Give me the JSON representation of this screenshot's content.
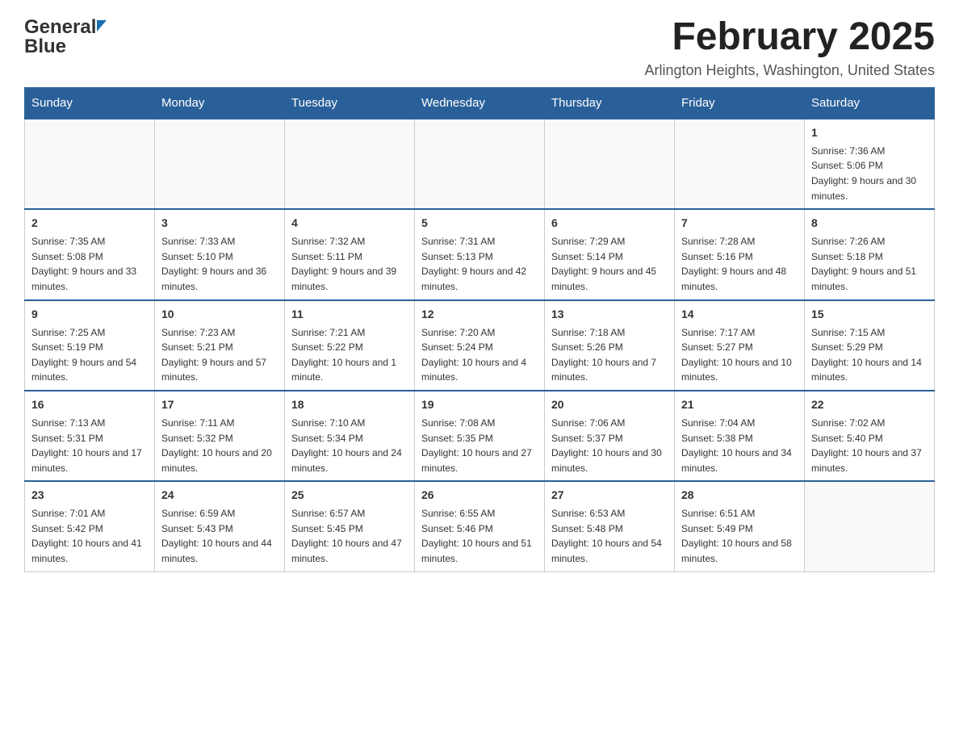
{
  "header": {
    "logo_general": "General",
    "logo_blue": "Blue",
    "month_title": "February 2025",
    "location": "Arlington Heights, Washington, United States"
  },
  "weekdays": [
    "Sunday",
    "Monday",
    "Tuesday",
    "Wednesday",
    "Thursday",
    "Friday",
    "Saturday"
  ],
  "weeks": [
    [
      {
        "day": "",
        "info": ""
      },
      {
        "day": "",
        "info": ""
      },
      {
        "day": "",
        "info": ""
      },
      {
        "day": "",
        "info": ""
      },
      {
        "day": "",
        "info": ""
      },
      {
        "day": "",
        "info": ""
      },
      {
        "day": "1",
        "info": "Sunrise: 7:36 AM\nSunset: 5:06 PM\nDaylight: 9 hours and 30 minutes."
      }
    ],
    [
      {
        "day": "2",
        "info": "Sunrise: 7:35 AM\nSunset: 5:08 PM\nDaylight: 9 hours and 33 minutes."
      },
      {
        "day": "3",
        "info": "Sunrise: 7:33 AM\nSunset: 5:10 PM\nDaylight: 9 hours and 36 minutes."
      },
      {
        "day": "4",
        "info": "Sunrise: 7:32 AM\nSunset: 5:11 PM\nDaylight: 9 hours and 39 minutes."
      },
      {
        "day": "5",
        "info": "Sunrise: 7:31 AM\nSunset: 5:13 PM\nDaylight: 9 hours and 42 minutes."
      },
      {
        "day": "6",
        "info": "Sunrise: 7:29 AM\nSunset: 5:14 PM\nDaylight: 9 hours and 45 minutes."
      },
      {
        "day": "7",
        "info": "Sunrise: 7:28 AM\nSunset: 5:16 PM\nDaylight: 9 hours and 48 minutes."
      },
      {
        "day": "8",
        "info": "Sunrise: 7:26 AM\nSunset: 5:18 PM\nDaylight: 9 hours and 51 minutes."
      }
    ],
    [
      {
        "day": "9",
        "info": "Sunrise: 7:25 AM\nSunset: 5:19 PM\nDaylight: 9 hours and 54 minutes."
      },
      {
        "day": "10",
        "info": "Sunrise: 7:23 AM\nSunset: 5:21 PM\nDaylight: 9 hours and 57 minutes."
      },
      {
        "day": "11",
        "info": "Sunrise: 7:21 AM\nSunset: 5:22 PM\nDaylight: 10 hours and 1 minute."
      },
      {
        "day": "12",
        "info": "Sunrise: 7:20 AM\nSunset: 5:24 PM\nDaylight: 10 hours and 4 minutes."
      },
      {
        "day": "13",
        "info": "Sunrise: 7:18 AM\nSunset: 5:26 PM\nDaylight: 10 hours and 7 minutes."
      },
      {
        "day": "14",
        "info": "Sunrise: 7:17 AM\nSunset: 5:27 PM\nDaylight: 10 hours and 10 minutes."
      },
      {
        "day": "15",
        "info": "Sunrise: 7:15 AM\nSunset: 5:29 PM\nDaylight: 10 hours and 14 minutes."
      }
    ],
    [
      {
        "day": "16",
        "info": "Sunrise: 7:13 AM\nSunset: 5:31 PM\nDaylight: 10 hours and 17 minutes."
      },
      {
        "day": "17",
        "info": "Sunrise: 7:11 AM\nSunset: 5:32 PM\nDaylight: 10 hours and 20 minutes."
      },
      {
        "day": "18",
        "info": "Sunrise: 7:10 AM\nSunset: 5:34 PM\nDaylight: 10 hours and 24 minutes."
      },
      {
        "day": "19",
        "info": "Sunrise: 7:08 AM\nSunset: 5:35 PM\nDaylight: 10 hours and 27 minutes."
      },
      {
        "day": "20",
        "info": "Sunrise: 7:06 AM\nSunset: 5:37 PM\nDaylight: 10 hours and 30 minutes."
      },
      {
        "day": "21",
        "info": "Sunrise: 7:04 AM\nSunset: 5:38 PM\nDaylight: 10 hours and 34 minutes."
      },
      {
        "day": "22",
        "info": "Sunrise: 7:02 AM\nSunset: 5:40 PM\nDaylight: 10 hours and 37 minutes."
      }
    ],
    [
      {
        "day": "23",
        "info": "Sunrise: 7:01 AM\nSunset: 5:42 PM\nDaylight: 10 hours and 41 minutes."
      },
      {
        "day": "24",
        "info": "Sunrise: 6:59 AM\nSunset: 5:43 PM\nDaylight: 10 hours and 44 minutes."
      },
      {
        "day": "25",
        "info": "Sunrise: 6:57 AM\nSunset: 5:45 PM\nDaylight: 10 hours and 47 minutes."
      },
      {
        "day": "26",
        "info": "Sunrise: 6:55 AM\nSunset: 5:46 PM\nDaylight: 10 hours and 51 minutes."
      },
      {
        "day": "27",
        "info": "Sunrise: 6:53 AM\nSunset: 5:48 PM\nDaylight: 10 hours and 54 minutes."
      },
      {
        "day": "28",
        "info": "Sunrise: 6:51 AM\nSunset: 5:49 PM\nDaylight: 10 hours and 58 minutes."
      },
      {
        "day": "",
        "info": ""
      }
    ]
  ]
}
